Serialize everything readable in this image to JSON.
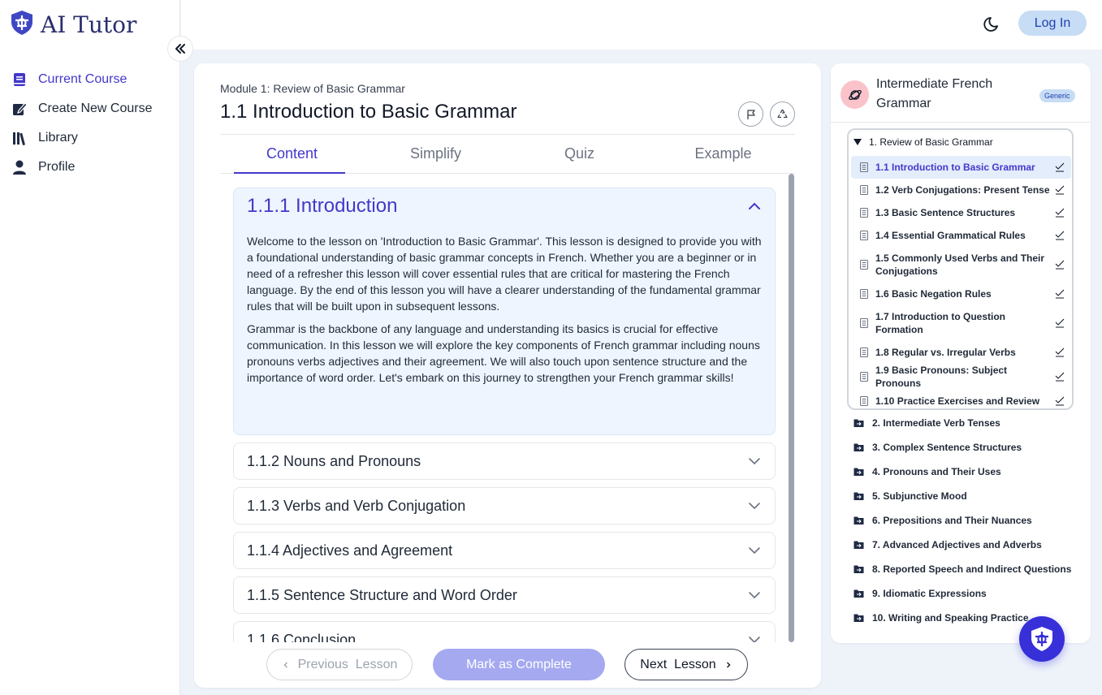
{
  "brand": {
    "name": "AI Tutor"
  },
  "nav": [
    {
      "label": "Current Course",
      "icon": "book-icon",
      "active": true
    },
    {
      "label": "Create New Course",
      "icon": "edit-icon",
      "active": false
    },
    {
      "label": "Library",
      "icon": "library-icon",
      "active": false
    },
    {
      "label": "Profile",
      "icon": "user-icon",
      "active": false
    }
  ],
  "topbar": {
    "login_label": "Log In"
  },
  "lesson": {
    "module_label": "Module 1: Review of Basic Grammar",
    "title": "1.1 Introduction to Basic Grammar"
  },
  "tabs": [
    "Content",
    "Simplify",
    "Quiz",
    "Example"
  ],
  "sections": [
    {
      "title": "1.1.1 Introduction",
      "paragraphs": [
        "Welcome to the lesson on 'Introduction to Basic Grammar'. This lesson is designed to provide you with a foundational understanding of basic grammar concepts in French. Whether you are a beginner or in need of a refresher this lesson will cover essential rules that are critical for mastering the French language. By the end of this lesson you will have a clearer understanding of the fundamental grammar rules that will be built upon in subsequent lessons.",
        "Grammar is the backbone of any language and understanding its basics is crucial for effective communication. In this lesson we will explore the key components of French grammar including nouns pronouns verbs adjectives and their agreement. We will also touch upon sentence structure and the importance of word order. Let's embark on this journey to strengthen your French grammar skills!"
      ]
    },
    {
      "title": "1.1.2 Nouns and Pronouns"
    },
    {
      "title": "1.1.3 Verbs and Verb Conjugation"
    },
    {
      "title": "1.1.4 Adjectives and Agreement"
    },
    {
      "title": "1.1.5 Sentence Structure and Word Order"
    },
    {
      "title": "1.1.6 Conclusion"
    }
  ],
  "footer": {
    "prev_label": "Previous  Lesson",
    "complete_label": "Mark as Complete",
    "next_label": "Next  Lesson"
  },
  "course": {
    "title": "Intermediate French Grammar",
    "badge": "Generic",
    "open_module": "1. Review of Basic Grammar",
    "lessons": [
      "1.1 Introduction to Basic Grammar",
      "1.2 Verb Conjugations: Present Tense",
      "1.3 Basic Sentence Structures",
      "1.4 Essential Grammatical Rules",
      "1.5 Commonly Used Verbs and Their Conjugations",
      "1.6 Basic Negation Rules",
      "1.7 Introduction to Question Formation",
      "1.8 Regular vs. Irregular Verbs",
      "1.9 Basic Pronouns: Subject Pronouns",
      "1.10 Practice Exercises and Review"
    ],
    "modules": [
      "2. Intermediate Verb Tenses",
      "3. Complex Sentence Structures",
      "4. Pronouns and Their Uses",
      "5. Subjunctive Mood",
      "6. Prepositions and Their Nuances",
      "7. Advanced Adjectives and Adverbs",
      "8. Reported Speech and Indirect Questions",
      "9. Idiomatic Expressions",
      "10. Writing and Speaking Practice"
    ]
  },
  "colors": {
    "accent": "#4338ca",
    "brand": "#2a2f6e",
    "fab": "#3730d9",
    "complete_button": "#a5a9f0"
  }
}
